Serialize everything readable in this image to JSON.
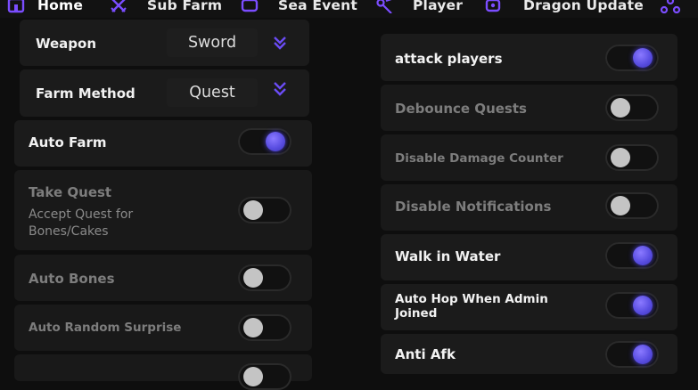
{
  "tabs": [
    {
      "label": "Home",
      "icon": "home-icon",
      "active": true
    },
    {
      "label": "Sub Farm",
      "icon": "crossed-swords-icon",
      "active": false
    },
    {
      "label": "Sea Event",
      "icon": "ship-icon",
      "active": false
    },
    {
      "label": "Player",
      "icon": "player-icon",
      "active": false
    },
    {
      "label": "Dragon Update",
      "icon": "dragon-icon",
      "active": false
    },
    {
      "label": "",
      "icon": "settings-icon",
      "active": false
    }
  ],
  "left": {
    "weapon": {
      "label": "Weapon",
      "value": "Sword"
    },
    "farm_method": {
      "label": "Farm Method",
      "value": "Quest"
    },
    "auto_farm": {
      "label": "Auto Farm",
      "on": true
    },
    "take_quest": {
      "label": "Take Quest",
      "desc": "Accept Quest for Bones/Cakes",
      "on": false
    },
    "auto_bones": {
      "label": "Auto Bones",
      "on": false
    },
    "auto_random_surprise": {
      "label": "Auto Random Surprise",
      "on": false
    }
  },
  "right": {
    "attack_players": {
      "label": "attack players",
      "on": true
    },
    "debounce_quests": {
      "label": "Debounce Quests",
      "on": false
    },
    "disable_damage_counter": {
      "label": "Disable Damage Counter",
      "on": false
    },
    "disable_notifications": {
      "label": "Disable Notifications",
      "on": false
    },
    "walk_in_water": {
      "label": "Walk in Water",
      "on": true
    },
    "auto_hop_admin": {
      "label": "Auto Hop When Admin Joined",
      "on": true
    },
    "anti_afk": {
      "label": "Anti Afk",
      "on": true
    }
  },
  "colors": {
    "accent": "#6b5cf0",
    "card": "#1b1b1b",
    "background": "#0e0e0e"
  }
}
